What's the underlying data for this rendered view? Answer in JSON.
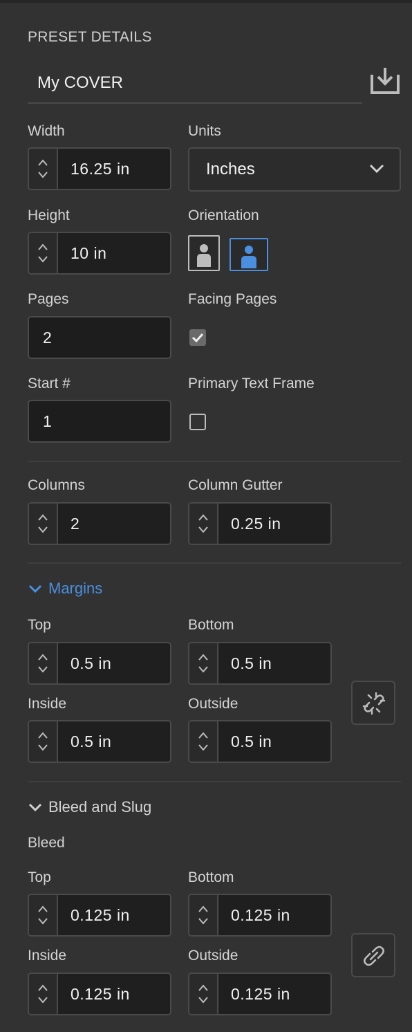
{
  "preset": {
    "section_title": "PRESET DETAILS",
    "name": "My COVER"
  },
  "width": {
    "label": "Width",
    "value": "16.25 in"
  },
  "units": {
    "label": "Units",
    "value": "Inches"
  },
  "height": {
    "label": "Height",
    "value": "10 in"
  },
  "orientation": {
    "label": "Orientation",
    "selected": "landscape"
  },
  "pages": {
    "label": "Pages",
    "value": "2"
  },
  "facing_pages": {
    "label": "Facing Pages",
    "checked": true
  },
  "start": {
    "label": "Start #",
    "value": "1"
  },
  "primary_text_frame": {
    "label": "Primary Text Frame",
    "checked": false
  },
  "columns": {
    "label": "Columns",
    "value": "2"
  },
  "column_gutter": {
    "label": "Column Gutter",
    "value": "0.25 in"
  },
  "margins": {
    "title": "Margins",
    "top_label": "Top",
    "top": "0.5 in",
    "bottom_label": "Bottom",
    "bottom": "0.5 in",
    "inside_label": "Inside",
    "inside": "0.5 in",
    "outside_label": "Outside",
    "outside": "0.5 in",
    "linked": false
  },
  "bleed_slug": {
    "title": "Bleed and Slug",
    "bleed_label": "Bleed",
    "top_label": "Top",
    "top": "0.125 in",
    "bottom_label": "Bottom",
    "bottom": "0.125 in",
    "inside_label": "Inside",
    "inside": "0.125 in",
    "outside_label": "Outside",
    "outside": "0.125 in",
    "linked": true
  },
  "colors": {
    "background": "#323232",
    "field_bg": "#1f1f1f",
    "border": "#4a4a4a",
    "accent": "#4a8fe0"
  }
}
